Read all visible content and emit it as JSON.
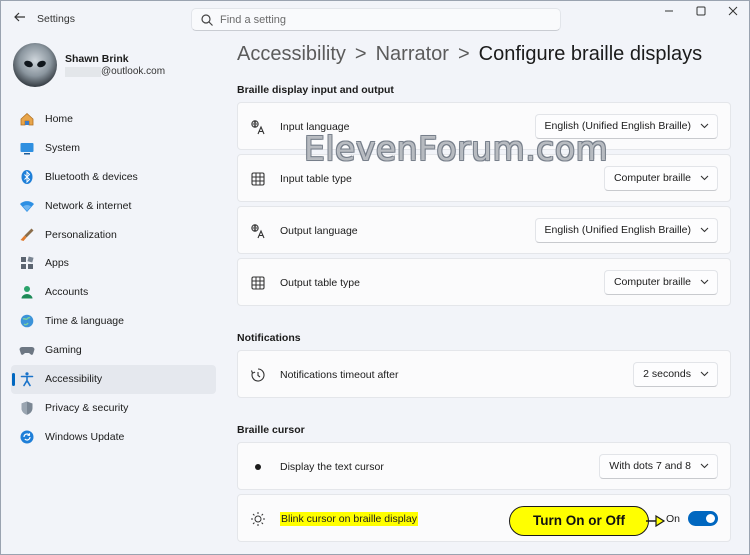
{
  "titlebar": {
    "app_title": "Settings",
    "search_placeholder": "Find a setting",
    "minimize_icon": "minimize-icon",
    "maximize_icon": "maximize-icon",
    "close_icon": "close-icon"
  },
  "profile": {
    "name": "Shawn Brink",
    "email": "@outlook.com"
  },
  "sidebar": {
    "items": [
      {
        "label": "Home",
        "icon": "home-icon"
      },
      {
        "label": "System",
        "icon": "system-icon"
      },
      {
        "label": "Bluetooth & devices",
        "icon": "bluetooth-icon"
      },
      {
        "label": "Network & internet",
        "icon": "wifi-icon"
      },
      {
        "label": "Personalization",
        "icon": "brush-icon"
      },
      {
        "label": "Apps",
        "icon": "apps-icon"
      },
      {
        "label": "Accounts",
        "icon": "accounts-icon"
      },
      {
        "label": "Time & language",
        "icon": "globe-icon"
      },
      {
        "label": "Gaming",
        "icon": "gamepad-icon"
      },
      {
        "label": "Accessibility",
        "icon": "accessibility-icon",
        "active": true
      },
      {
        "label": "Privacy & security",
        "icon": "shield-icon"
      },
      {
        "label": "Windows Update",
        "icon": "update-icon"
      }
    ]
  },
  "breadcrumb": {
    "items": [
      "Accessibility",
      "Narrator"
    ],
    "separator": ">",
    "current": "Configure braille displays"
  },
  "sections": {
    "io": {
      "title": "Braille display input and output",
      "rows": [
        {
          "label": "Input language",
          "value": "English (Unified English Braille)",
          "icon": "language-icon"
        },
        {
          "label": "Input table type",
          "value": "Computer braille",
          "icon": "table-icon"
        },
        {
          "label": "Output language",
          "value": "English (Unified English Braille)",
          "icon": "language-icon"
        },
        {
          "label": "Output table type",
          "value": "Computer braille",
          "icon": "table-icon"
        }
      ]
    },
    "notifications": {
      "title": "Notifications",
      "rows": [
        {
          "label": "Notifications timeout after",
          "value": "2 seconds",
          "icon": "timer-icon"
        }
      ]
    },
    "cursor": {
      "title": "Braille cursor",
      "rows": [
        {
          "label": "Display the text cursor",
          "value": "With dots 7 and 8",
          "icon": "dot-icon"
        },
        {
          "label": "Blink cursor on braille display",
          "toggle_state": "On",
          "toggle_on": true,
          "icon": "brightness-icon"
        }
      ]
    }
  },
  "annotation": {
    "callout_text": "Turn On or Off",
    "watermark": "ElevenForum.com"
  },
  "colors": {
    "accent": "#0067c0",
    "highlight": "#ffff00"
  }
}
